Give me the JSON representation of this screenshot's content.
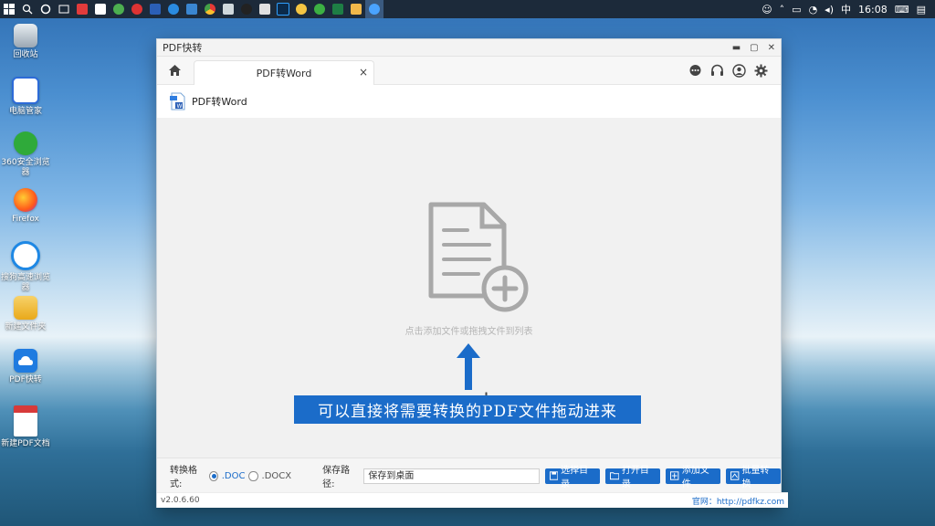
{
  "taskbar": {
    "time": "16:08",
    "ime": "中"
  },
  "desktop": {
    "icons": [
      {
        "label": "回收站",
        "color": "#9aa7b3"
      },
      {
        "label": "电脑管家",
        "color": "#2d6bd8"
      },
      {
        "label": "360安全浏览器",
        "color": "#2faa3a"
      },
      {
        "label": "Firefox",
        "color": "#ff7a1a"
      },
      {
        "label": "搜狗高速浏览器",
        "color": "#1e88e5"
      },
      {
        "label": "新建文件夹",
        "color": "#f0b429"
      },
      {
        "label": "PDF快转",
        "color": "#1f7be0"
      },
      {
        "label": "新建PDF文档",
        "color": "#d73a3a"
      }
    ]
  },
  "window": {
    "title": "PDF快转",
    "tab_label": "PDF转Word",
    "tab_close": "×",
    "subheader_label": "PDF转Word",
    "drop_hint": "点击添加文件或拖拽文件到列表",
    "banner_text": "可以直接将需要转换的PDF文件拖动进来",
    "bottom": {
      "format_label": "转换格式:",
      "option_doc": ".DOC",
      "option_docx": ".DOCX",
      "path_label": "保存路径:",
      "path_value": "保存到桌面",
      "btn_select_dir": "选择目录",
      "btn_open_dir": "打开目录",
      "btn_add_file": "添加文件",
      "btn_batch": "批量转换"
    },
    "status": {
      "version": "v2.0.6.60",
      "site": "官网：http://pdfkz.com"
    }
  },
  "colors": {
    "accent": "#1b6cc9"
  }
}
